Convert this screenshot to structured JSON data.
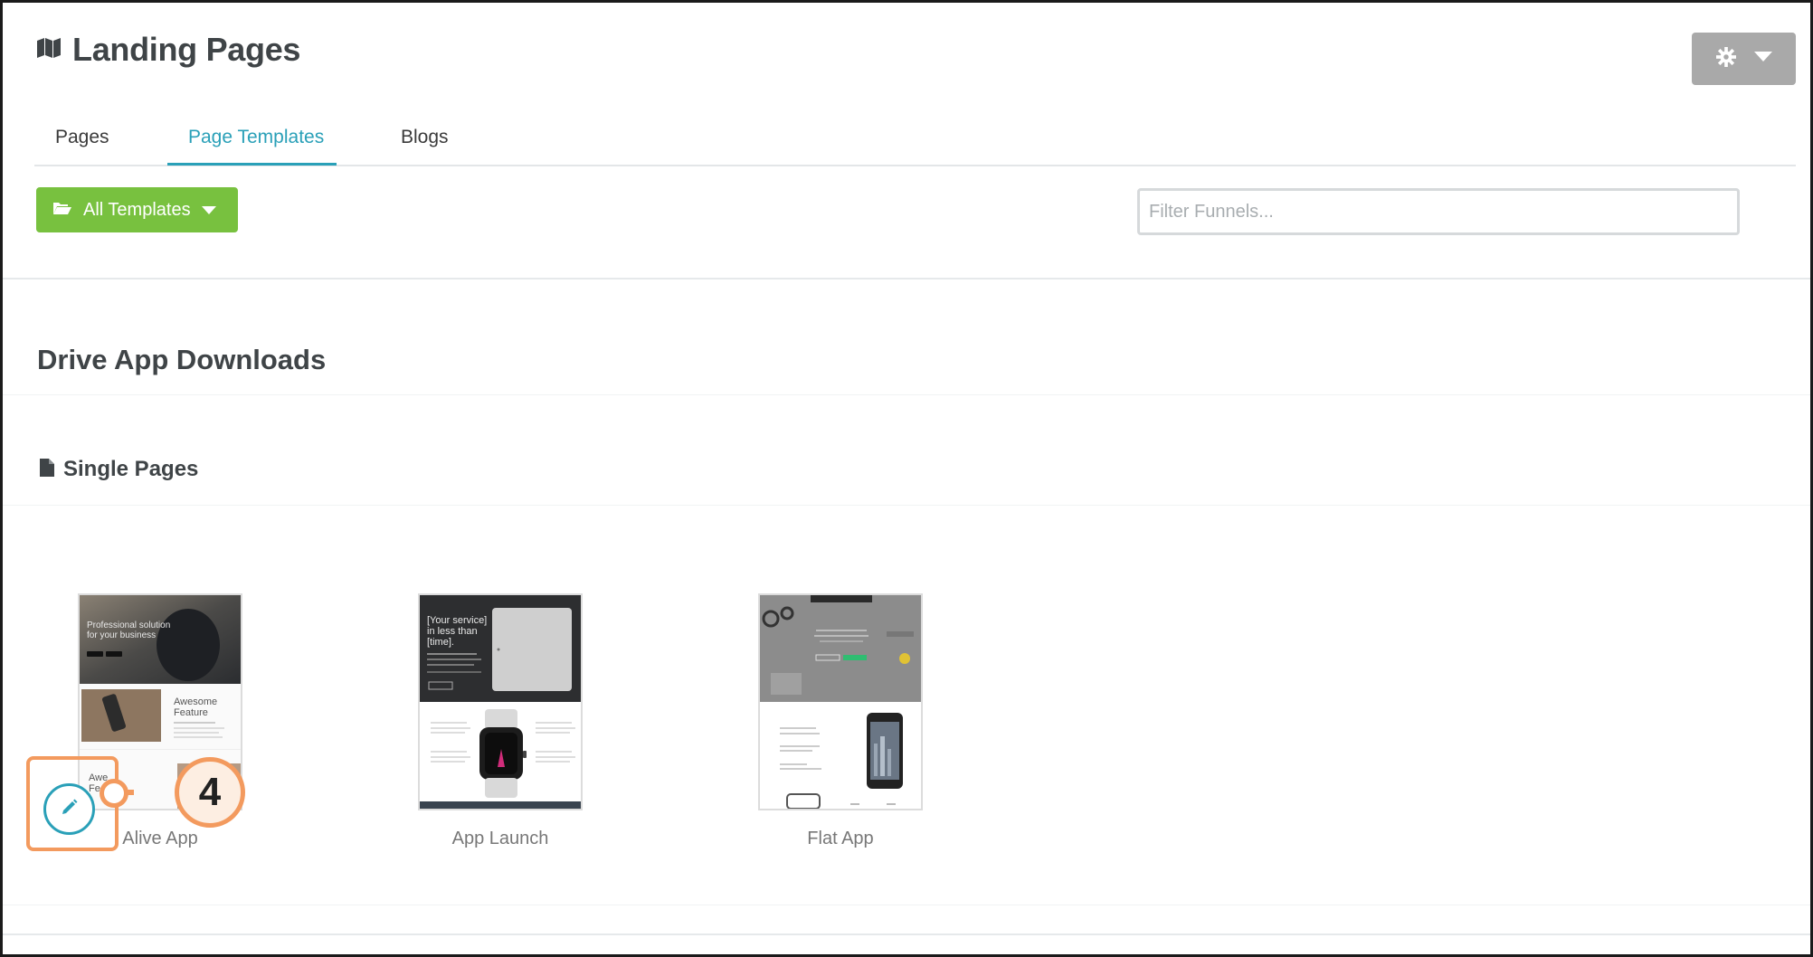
{
  "header": {
    "title": "Landing Pages",
    "icon": "map-icon",
    "settings_icon": "gear-icon",
    "settings_caret": "caret-down-icon"
  },
  "tabs": [
    {
      "label": "Pages",
      "active": false
    },
    {
      "label": "Page Templates",
      "active": true
    },
    {
      "label": "Blogs",
      "active": false
    }
  ],
  "toolbar": {
    "templates_button_label": "All Templates",
    "templates_button_icon": "folder-open-icon",
    "filter_placeholder": "Filter Funnels..."
  },
  "section": {
    "title": "Drive App Downloads",
    "subsection_label": "Single Pages",
    "subsection_icon": "document-icon"
  },
  "templates": [
    {
      "name": "Alive App"
    },
    {
      "name": "App Launch"
    },
    {
      "name": "Flat App"
    }
  ],
  "thumb_text": {
    "alive_hero": "Professional solution for your business",
    "alive_feature_1": "Awesome Feature",
    "alive_feature_2": "Awe Fe",
    "launch_hero": "[Your service] in less than [time]."
  },
  "annotation": {
    "step_number": "4",
    "edit_icon": "pencil-icon"
  },
  "colors": {
    "accent": "#2aa0b8",
    "button_green": "#78c13f",
    "settings_gray": "#a9a9a9",
    "callout_orange": "#f39a5e"
  }
}
